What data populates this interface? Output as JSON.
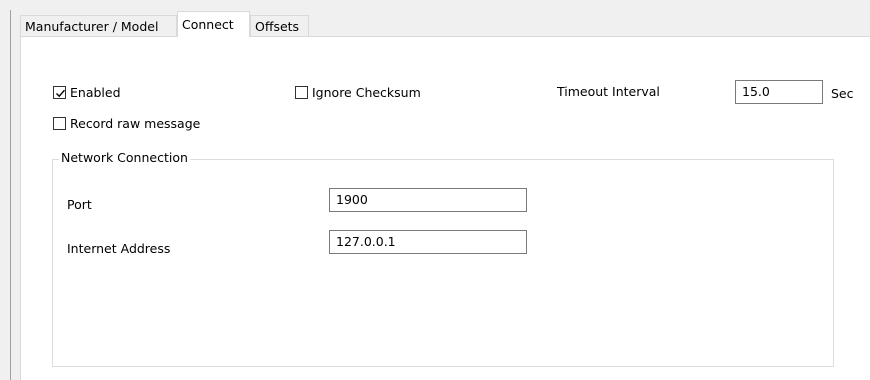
{
  "tabs": [
    {
      "label": "Manufacturer / Model",
      "active": false
    },
    {
      "label": "Connect",
      "active": true
    },
    {
      "label": "Offsets",
      "active": false
    }
  ],
  "options": {
    "enabled": {
      "label": "Enabled",
      "checked": true
    },
    "ignore_checksum": {
      "label": "Ignore Checksum",
      "checked": false
    },
    "record_raw": {
      "label": "Record raw message",
      "checked": false
    },
    "timeout": {
      "label": "Timeout Interval",
      "value": "15.0",
      "unit": "Sec"
    }
  },
  "network": {
    "title": "Network Connection",
    "port": {
      "label": "Port",
      "value": "1900"
    },
    "address": {
      "label": "Internet Address",
      "value": "127.0.0.1"
    }
  }
}
